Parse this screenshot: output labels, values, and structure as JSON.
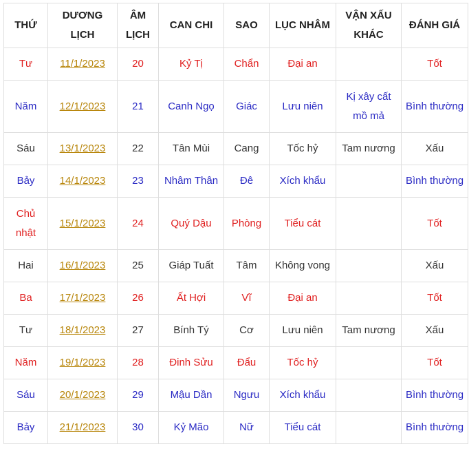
{
  "headers": [
    "THỨ",
    "DƯƠNG LỊCH",
    "ÂM LỊCH",
    "CAN CHI",
    "SAO",
    "LỤC NHÂM",
    "VẬN XẤU KHÁC",
    "ĐÁNH GIÁ"
  ],
  "colors": {
    "red": "#e02020",
    "blue": "#2b2bc4",
    "black": "#333333",
    "link": "#b8860b",
    "border": "#dedede"
  },
  "rows": [
    {
      "thu": "Tư",
      "duong_lich": "11/1/2023",
      "am_lich": "20",
      "can_chi": "Kỷ Tị",
      "sao": "Chẩn",
      "luc_nham": "Đại an",
      "van_xau": "",
      "danh_gia": "Tốt",
      "tone": "red"
    },
    {
      "thu": "Năm",
      "duong_lich": "12/1/2023",
      "am_lich": "21",
      "can_chi": "Canh Ngọ",
      "sao": "Giác",
      "luc_nham": "Lưu niên",
      "van_xau": "Kị xây cất mồ mả",
      "danh_gia": "Bình thường",
      "tone": "blue"
    },
    {
      "thu": "Sáu",
      "duong_lich": "13/1/2023",
      "am_lich": "22",
      "can_chi": "Tân Mùi",
      "sao": "Cang",
      "luc_nham": "Tốc hỷ",
      "van_xau": "Tam nương",
      "danh_gia": "Xấu",
      "tone": "black"
    },
    {
      "thu": "Bảy",
      "duong_lich": "14/1/2023",
      "am_lich": "23",
      "can_chi": "Nhâm Thân",
      "sao": "Đê",
      "luc_nham": "Xích khẩu",
      "van_xau": "",
      "danh_gia": "Bình thường",
      "tone": "blue"
    },
    {
      "thu": "Chủ nhật",
      "duong_lich": "15/1/2023",
      "am_lich": "24",
      "can_chi": "Quý Dậu",
      "sao": "Phòng",
      "luc_nham": "Tiểu cát",
      "van_xau": "",
      "danh_gia": "Tốt",
      "tone": "red"
    },
    {
      "thu": "Hai",
      "duong_lich": "16/1/2023",
      "am_lich": "25",
      "can_chi": "Giáp Tuất",
      "sao": "Tâm",
      "luc_nham": "Không vong",
      "van_xau": "",
      "danh_gia": "Xấu",
      "tone": "black"
    },
    {
      "thu": "Ba",
      "duong_lich": "17/1/2023",
      "am_lich": "26",
      "can_chi": "Ất Hợi",
      "sao": "Vĩ",
      "luc_nham": "Đại an",
      "van_xau": "",
      "danh_gia": "Tốt",
      "tone": "red"
    },
    {
      "thu": "Tư",
      "duong_lich": "18/1/2023",
      "am_lich": "27",
      "can_chi": "Bính Tý",
      "sao": "Cơ",
      "luc_nham": "Lưu niên",
      "van_xau": "Tam nương",
      "danh_gia": "Xấu",
      "tone": "black"
    },
    {
      "thu": "Năm",
      "duong_lich": "19/1/2023",
      "am_lich": "28",
      "can_chi": "Đinh Sửu",
      "sao": "Đẩu",
      "luc_nham": "Tốc hỷ",
      "van_xau": "",
      "danh_gia": "Tốt",
      "tone": "red"
    },
    {
      "thu": "Sáu",
      "duong_lich": "20/1/2023",
      "am_lich": "29",
      "can_chi": "Mậu Dần",
      "sao": "Ngưu",
      "luc_nham": "Xích khẩu",
      "van_xau": "",
      "danh_gia": "Bình thường",
      "tone": "blue"
    },
    {
      "thu": "Bảy",
      "duong_lich": "21/1/2023",
      "am_lich": "30",
      "can_chi": "Kỷ Mão",
      "sao": "Nữ",
      "luc_nham": "Tiểu cát",
      "van_xau": "",
      "danh_gia": "Bình thường",
      "tone": "blue"
    }
  ]
}
